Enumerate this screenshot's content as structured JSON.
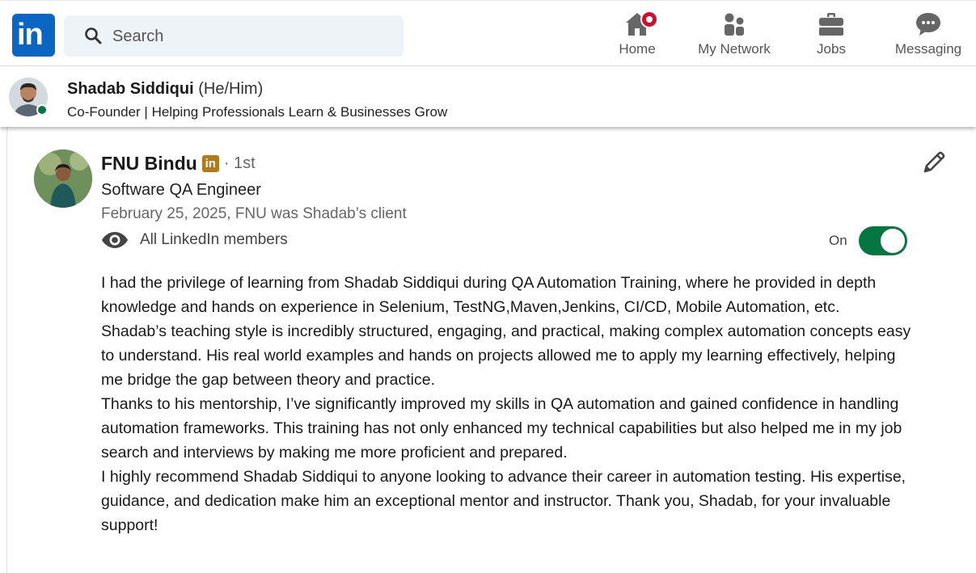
{
  "nav": {
    "search_placeholder": "Search",
    "items": [
      {
        "label": "Home",
        "icon": "home-icon",
        "has_notification": true
      },
      {
        "label": "My Network",
        "icon": "people-icon"
      },
      {
        "label": "Jobs",
        "icon": "briefcase-icon"
      },
      {
        "label": "Messaging",
        "icon": "chat-icon"
      }
    ]
  },
  "profile": {
    "name": "Shadab Siddiqui",
    "pronouns": "(He/Him)",
    "headline": "Co-Founder | Helping Professionals Learn & Businesses Grow",
    "online": true
  },
  "recommendation": {
    "author_name": "FNU Bindu",
    "badge_icon": "linkedin-premium-icon",
    "degree": "· 1st",
    "author_title": "Software QA Engineer",
    "date_relation": "February 25, 2025, FNU was Shadab’s client",
    "visibility": "All LinkedIn members",
    "toggle_label": "On",
    "toggle_on": true,
    "paragraphs": [
      "I had the privilege of learning from Shadab Siddiqui during QA Automation Training, where he provided in depth knowledge and hands on experience in Selenium, TestNG,Maven,Jenkins, CI/CD, Mobile Automation, etc.",
      "Shadab’s teaching style is incredibly structured, engaging, and practical, making complex automation concepts easy to understand. His real world examples and hands on projects allowed me to apply my learning effectively, helping me bridge the gap between theory and practice.",
      "Thanks to his mentorship, I’ve significantly improved my skills in QA automation and gained confidence in handling automation frameworks. This training has not only enhanced my technical capabilities but also helped me in my job search and interviews by making me more proficient and prepared.",
      "I highly recommend Shadab Siddiqui to anyone looking to advance their career in automation testing. His expertise, guidance, and dedication make him an exceptional mentor and instructor. Thank you, Shadab, for your invaluable support!"
    ]
  },
  "colors": {
    "brand": "#0a66c2",
    "toggle_on": "#057642",
    "notification": "#cb112d"
  }
}
